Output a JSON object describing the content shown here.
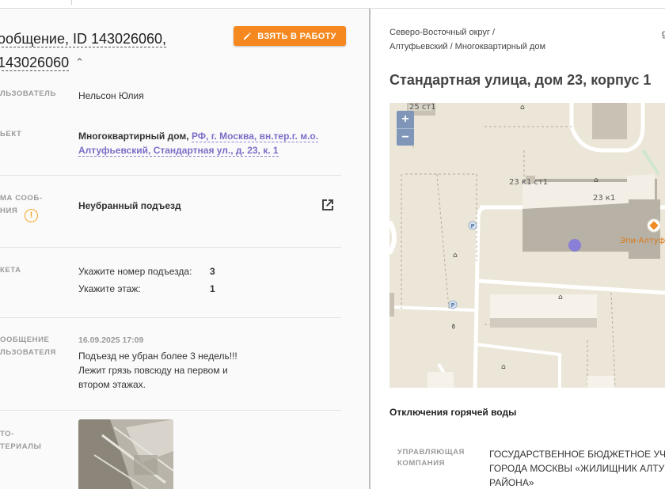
{
  "ticket": {
    "title_line1": "ообщение, ID 143026060,",
    "title_line2": "143026060",
    "take_button": "ВЗЯТЬ В РАБОТУ"
  },
  "fields": {
    "user_label": "ЛЬЗОВАТЕЛЬ",
    "user_value": "Нельсон Юлия",
    "object_label": "ЬЕКТ",
    "object_type": "Многоквартирный дом,",
    "object_address": "РФ, г. Москва, вн.тер.г. м.о. Алтуфьевский, Стандартная ул., д. 23, к. 1",
    "topic_label_1": "МА СООБ-",
    "topic_label_2": "НИЯ",
    "topic_value": "Неубранный подъезд",
    "survey_label": "КЕТА",
    "survey": [
      {
        "q": "Укажите номер подъезда:",
        "a": "3"
      },
      {
        "q": "Укажите этаж:",
        "a": "1"
      }
    ],
    "message_label_1": "ООБЩЕНИЕ",
    "message_label_2": "ЛЬЗОВАТЕЛЯ",
    "message_datetime": "16.09.2025 17:09",
    "message_line1": "Подъезд не убран более 3 недель!!!",
    "message_line2": "Лежит грязь повсюду на первом и",
    "message_line3": "втором этажах.",
    "photo_label_1": "ТО-",
    "photo_label_2": "ТЕРИАЛЫ"
  },
  "right": {
    "breadcrumb_line1": "Северо-Восточный округ /",
    "breadcrumb_line2": "Алтуфьевский / Многоквартирный дом",
    "title": "Стандартная улица, дом 23, корпус 1",
    "map": {
      "zoom_in": "+",
      "zoom_out": "−",
      "labels": {
        "b1": "25 ст1",
        "b2": "23 к1 ст1",
        "b3": "23 к1",
        "poi": "Эпи-Алтуф",
        "p": "P"
      }
    },
    "hot_water": "Отключения горячей воды",
    "mc_label_1": "УПРАВЛЯЮЩАЯ",
    "mc_label_2": "КОМПАНИЯ",
    "mc_line1": "ГОСУДАРСТВЕННОЕ БЮДЖЕТНОЕ УЧР",
    "mc_line2": "ГОРОДА МОСКВЫ «ЖИЛИЩНИК АЛТУ",
    "mc_line3": "РАЙОНА»"
  },
  "colors": {
    "accent": "#f5891f",
    "link": "#7a6fc8",
    "warning": "#f5a623",
    "map_bg": "#ebe6d7",
    "marker": "#8a7fd6"
  }
}
